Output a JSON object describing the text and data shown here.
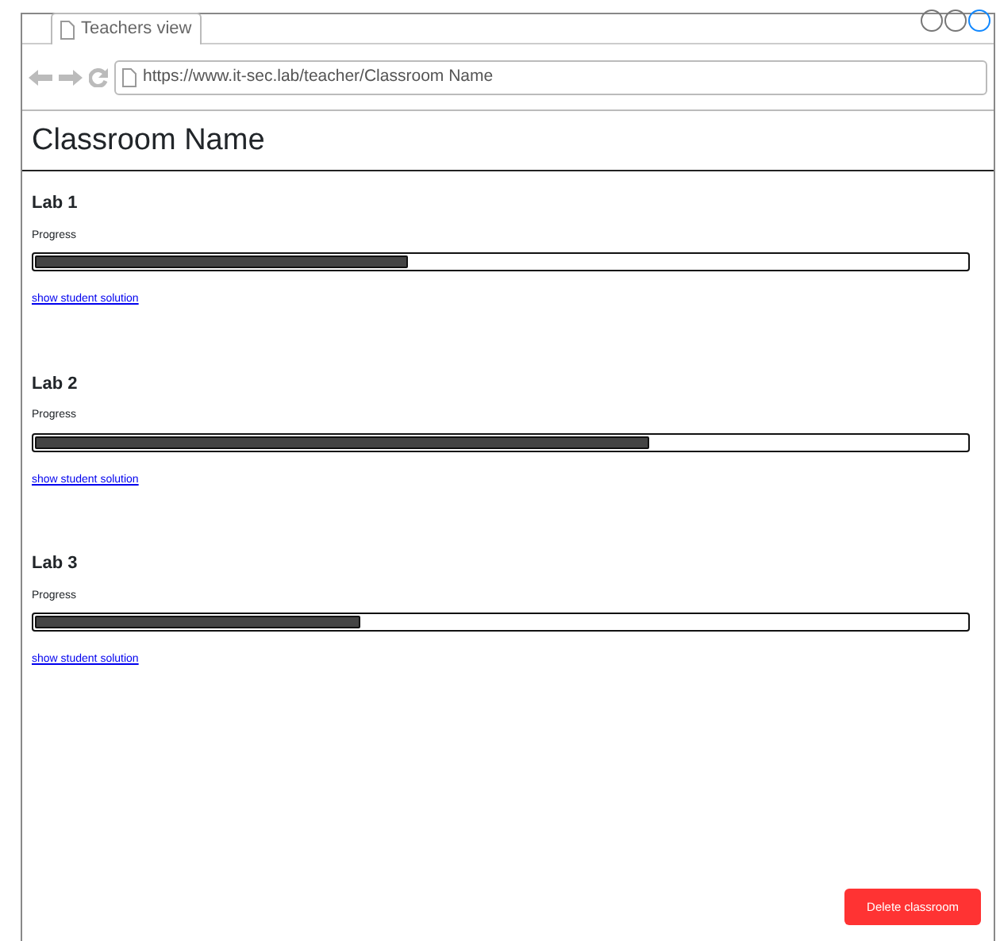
{
  "window": {
    "tab_title": "Teachers view",
    "url": "https://www.it-sec.lab/teacher/Classroom Name"
  },
  "page_title": "Classroom Name",
  "labs": [
    {
      "title": "Lab 1",
      "progress_label": "Progress",
      "level": 0.4,
      "link": "show student solution"
    },
    {
      "title": "Lab 2",
      "progress_label": "Progress",
      "level": 0.66,
      "link": "show student solution"
    },
    {
      "title": "Lab 3",
      "progress_label": "Progress",
      "level": 0.35,
      "link": "show student solution"
    }
  ],
  "delete_button": "Delete classroom"
}
